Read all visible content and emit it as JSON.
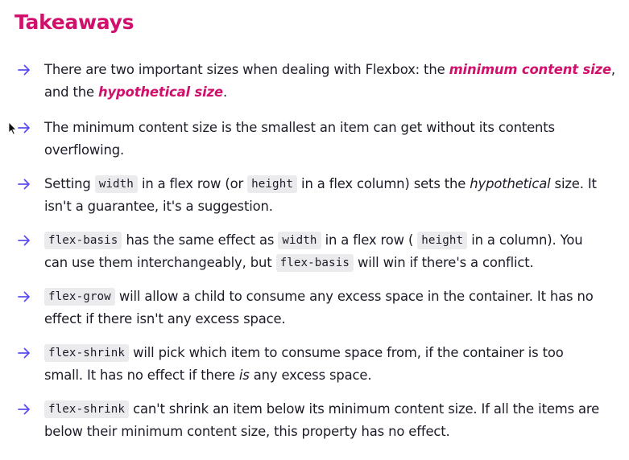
{
  "title": "Takeaways",
  "items": [
    {
      "line1_a": "There are two important sizes when dealing with Flexbox: the ",
      "line1_em": "minimum content size",
      "line1_b": ",",
      "line2_a": "and the ",
      "line2_em": "hypothetical size",
      "line2_b": "."
    },
    {
      "line1": "The minimum content size is the smallest an item can get without its contents",
      "line2": "overflowing."
    },
    {
      "line1_a": "Setting ",
      "code1": "width",
      "line1_b": " in a flex row (or ",
      "code2": "height",
      "line1_c": " in a flex column) sets the ",
      "line1_it": "hypothetical",
      "line1_d": " size. It",
      "line2": "isn't a guarantee, it's a suggestion."
    },
    {
      "code1": "flex-basis",
      "line1_a": " has the same effect as ",
      "code2": "width",
      "line1_b": " in a flex row ( ",
      "code3": "height",
      "line1_c": " in a column). You",
      "line2_a": "can use them interchangeably, but ",
      "code4": "flex-basis",
      "line2_b": " will win if there's a conflict."
    },
    {
      "code1": "flex-grow",
      "line1_a": " will allow a child to consume any excess space in the container. It has no",
      "line2": "effect if there isn't any excess space."
    },
    {
      "code1": "flex-shrink",
      "line1_a": " will pick which item to consume space from, if the container is too",
      "line2_a": "small. It has no effect if there ",
      "line2_it": "is",
      "line2_b": " any excess space."
    },
    {
      "code1": "flex-shrink",
      "line1_a": " can't shrink an item below its minimum content size. If all the items are",
      "line2": "below their minimum content size, this property has no effect."
    }
  ],
  "colors": {
    "accent": "#d1106c",
    "arrow": "#5b4df0",
    "text": "#1c1c28",
    "code_bg": "#ebebee"
  },
  "icons": {
    "bullet": "arrow-right-icon",
    "cursor": "mouse-pointer-icon"
  }
}
